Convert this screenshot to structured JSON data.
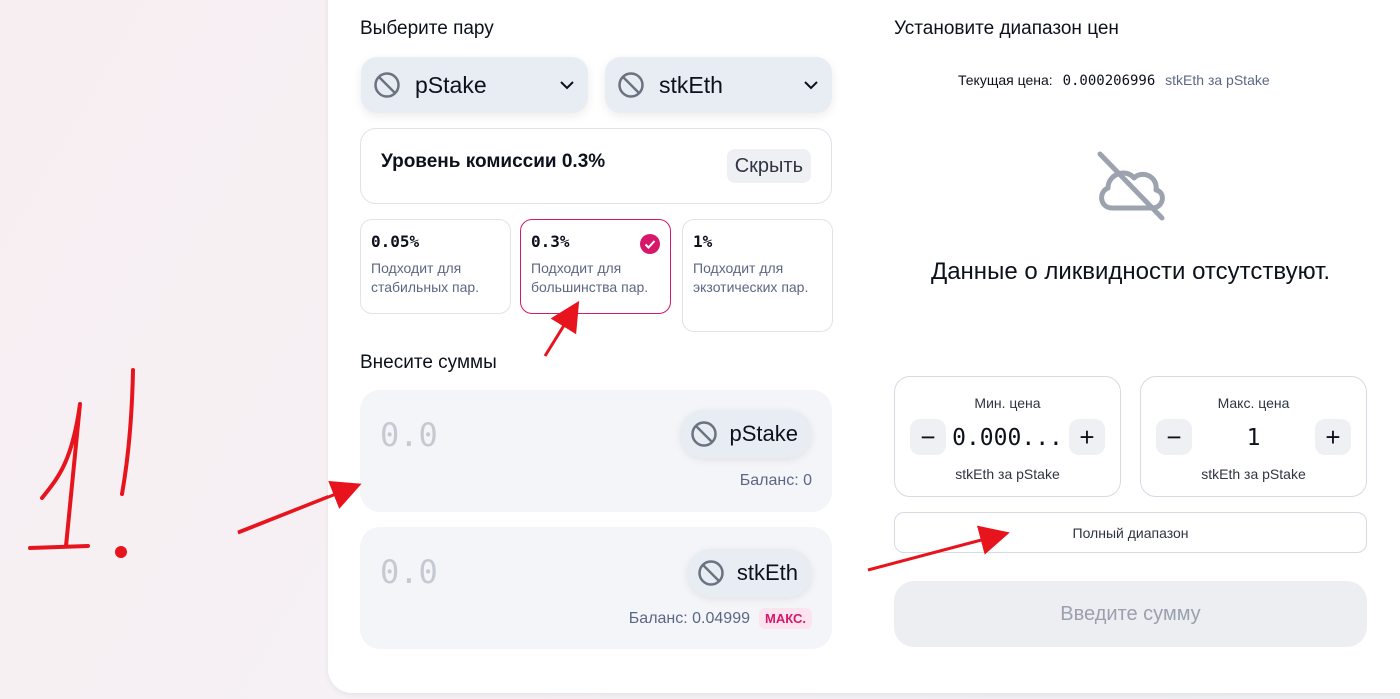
{
  "left": {
    "pair_title": "Выберите пару",
    "token_a": "pStake",
    "token_b": "stkEth",
    "fee_label": "Уровень комиссии 0.3%",
    "hide_label": "Скрыть",
    "tiers": [
      {
        "pct": "0.05%",
        "desc": "Подходит для стабильных пар."
      },
      {
        "pct": "0.3%",
        "desc": "Подходит для большинства пар."
      },
      {
        "pct": "1%",
        "desc": "Подходит для экзотических пар."
      }
    ],
    "deposit_title": "Внесите суммы",
    "amount_a": "0.0",
    "amount_b": "0.0",
    "balance_a": "Баланс: 0",
    "balance_b": "Баланс: 0.04999",
    "max_label": "МАКС."
  },
  "right": {
    "range_title": "Установите диапазон цен",
    "current_price_label": "Текущая цена:",
    "current_price_value": "0.000206996",
    "current_price_unit": "stkEth за pStake",
    "no_data": "Данные о ликвидности отсутствуют.",
    "min_title": "Мин. цена",
    "min_value": "0.000...",
    "max_title": "Макс. цена",
    "max_value": "1",
    "price_unit": "stkEth за pStake",
    "minus": "−",
    "plus": "+",
    "full_range": "Полный диапазон",
    "submit": "Введите сумму"
  },
  "annotation": {
    "color": "#e8141d",
    "text": "1!"
  },
  "colors": {
    "accent": "#d5186a",
    "annotation": "#e8141d"
  }
}
